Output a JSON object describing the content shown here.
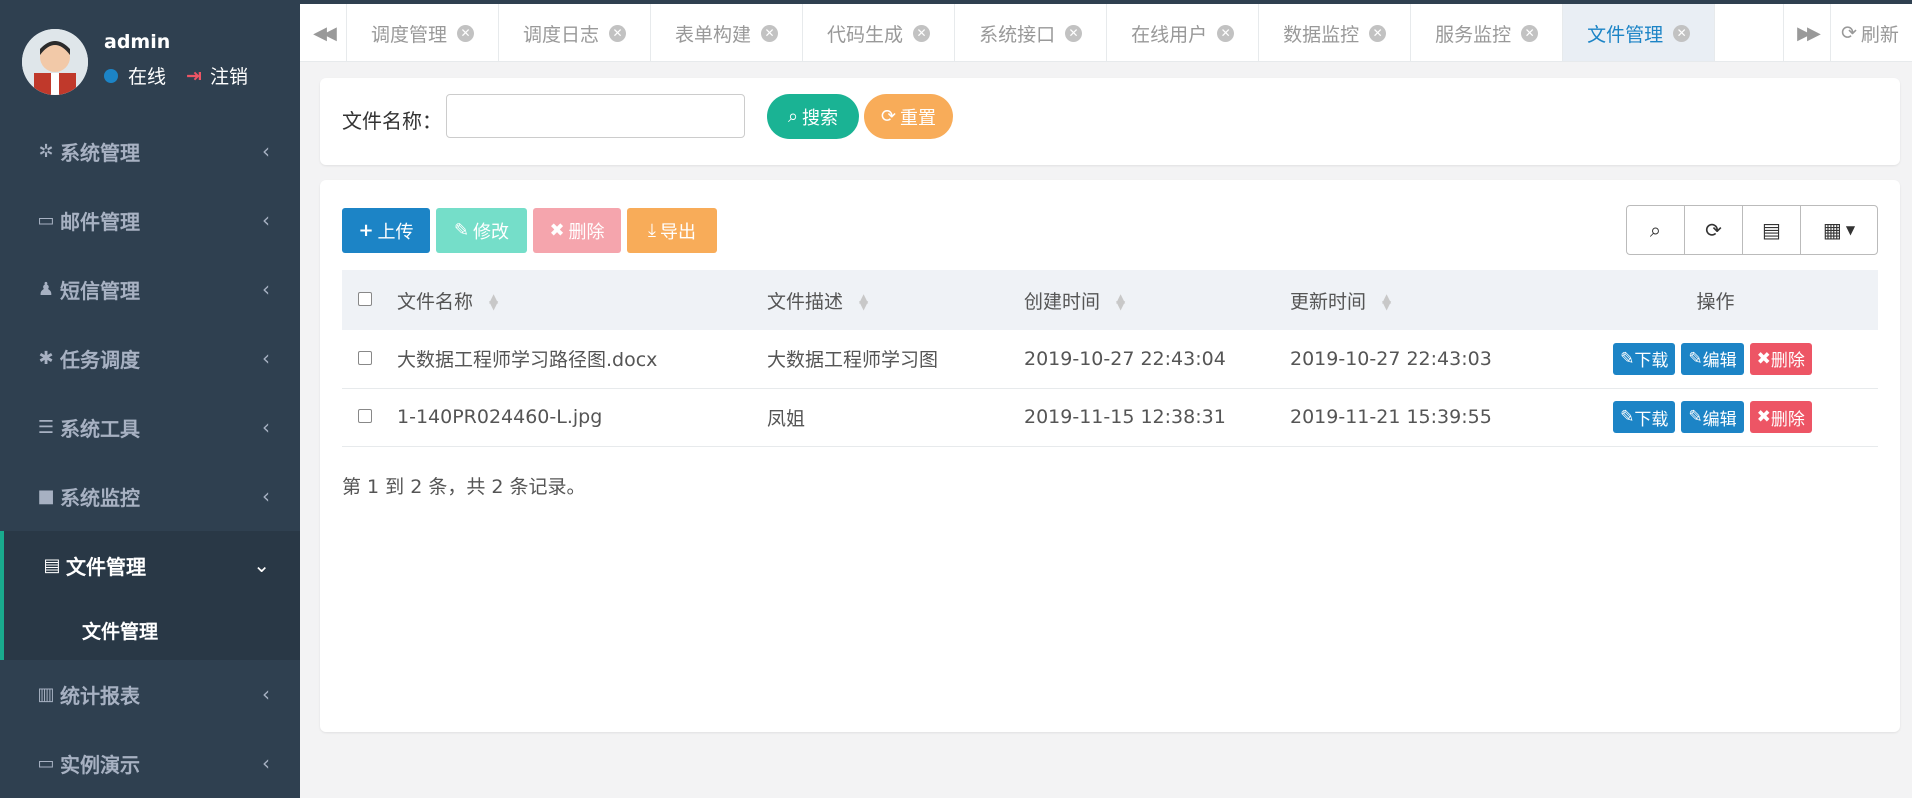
{
  "user": {
    "name": "admin",
    "status": "在线",
    "logout": "注销"
  },
  "menu": [
    {
      "icon": "gear-icon",
      "glyph": "✲",
      "label": "系统管理"
    },
    {
      "icon": "calendar-icon",
      "glyph": "▭",
      "label": "邮件管理"
    },
    {
      "icon": "bell-icon",
      "glyph": "♟",
      "label": "短信管理"
    },
    {
      "icon": "asterisk-icon",
      "glyph": "✱",
      "label": "任务调度"
    },
    {
      "icon": "list-icon",
      "glyph": "☰",
      "label": "系统工具"
    },
    {
      "icon": "video-icon",
      "glyph": "■",
      "label": "系统监控"
    },
    {
      "icon": "book-icon",
      "glyph": "▤",
      "label": "文件管理"
    },
    {
      "icon": "bar-chart-icon",
      "glyph": "▥",
      "label": "统计报表"
    },
    {
      "icon": "desktop-icon",
      "glyph": "▭",
      "label": "实例演示"
    }
  ],
  "submenu": {
    "label": "文件管理"
  },
  "tabs": [
    "调度管理",
    "调度日志",
    "表单构建",
    "代码生成",
    "系统接口",
    "在线用户",
    "数据监控",
    "服务监控",
    "文件管理"
  ],
  "tabbar": {
    "refresh": "刷新"
  },
  "search": {
    "label": "文件名称：",
    "value": "",
    "search_btn": "搜索",
    "reset_btn": "重置"
  },
  "toolbar": {
    "upload": "上传",
    "edit": "修改",
    "delete": "删除",
    "export": "导出"
  },
  "table": {
    "columns": [
      "文件名称",
      "文件描述",
      "创建时间",
      "更新时间",
      "操作"
    ],
    "rows": [
      {
        "name": "大数据工程师学习路径图.docx",
        "desc": "大数据工程师学习图",
        "created": "2019-10-27 22:43:04",
        "updated": "2019-10-27 22:43:03"
      },
      {
        "name": "1-140PR024460-L.jpg",
        "desc": "凤姐",
        "created": "2019-11-15 12:38:31",
        "updated": "2019-11-21 15:39:55"
      }
    ],
    "actions": {
      "download": "下载",
      "edit": "编辑",
      "delete": "删除"
    }
  },
  "pager": "第 1 到 2 条，共 2 条记录。",
  "colors": {
    "sidebar": "#2f4050",
    "primary": "#1c84c6",
    "green": "#1ab394",
    "orange": "#f8ac59",
    "red": "#ed5565"
  }
}
